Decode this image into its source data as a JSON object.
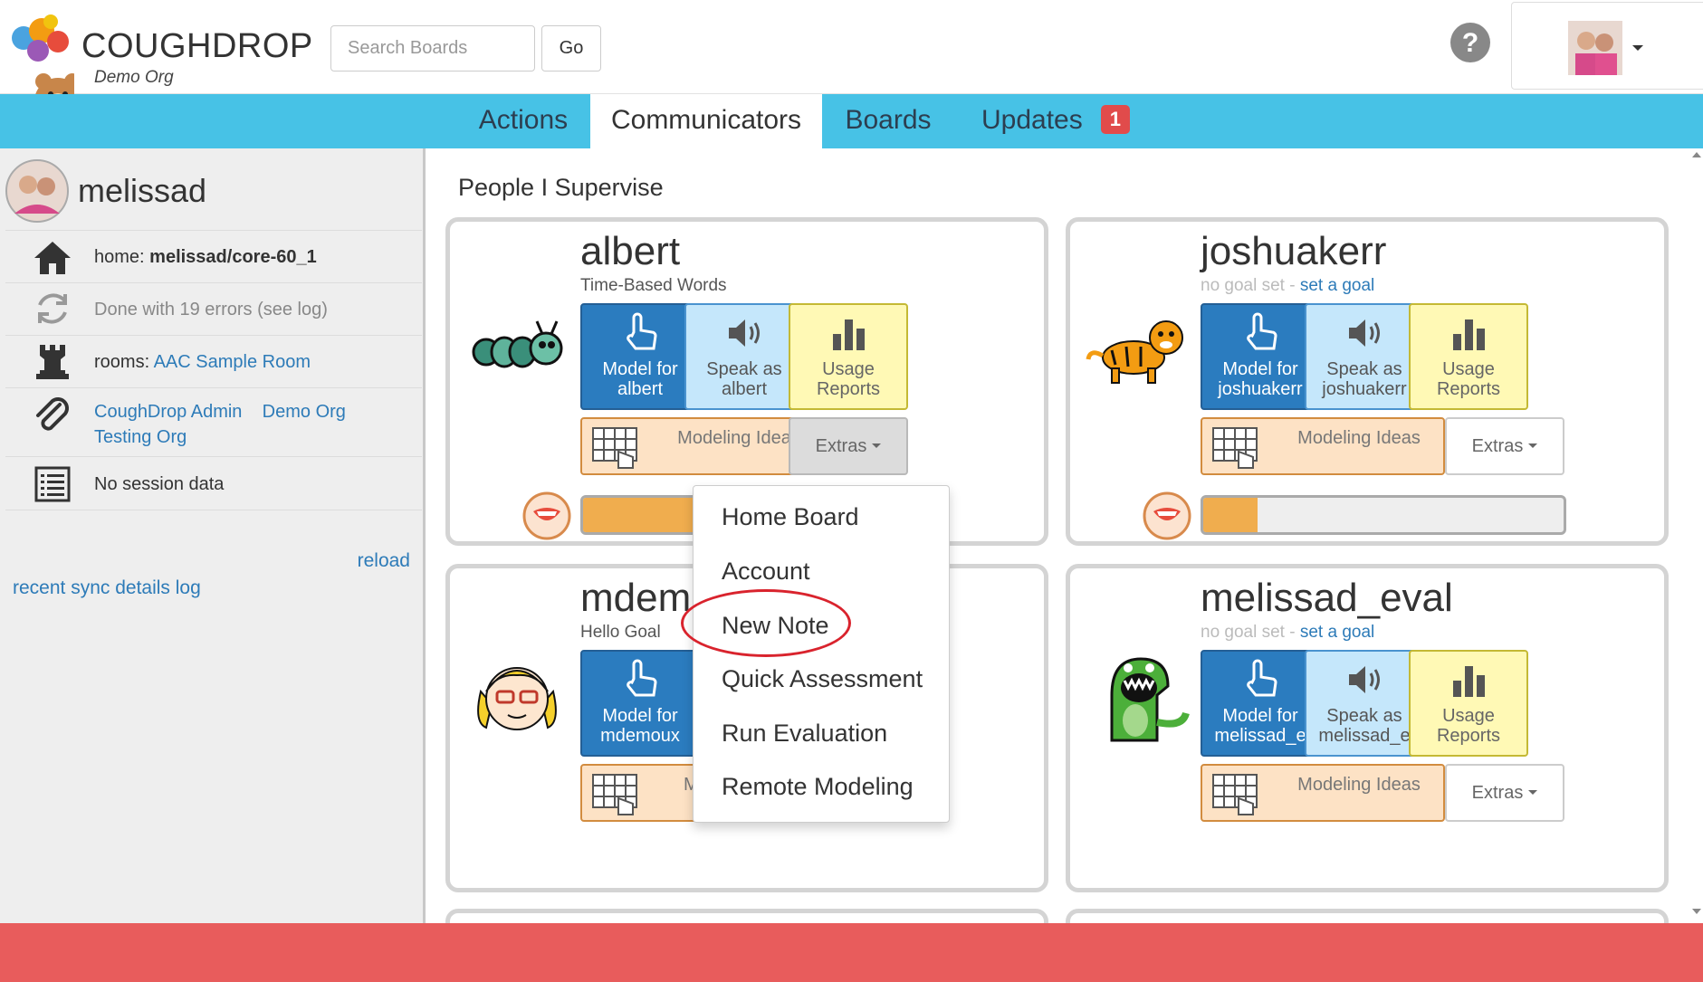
{
  "header": {
    "brand": "COUGHDROP",
    "org": "Demo Org",
    "search_placeholder": "Search Boards",
    "go_label": "Go"
  },
  "nav": {
    "tabs": [
      {
        "label": "Actions"
      },
      {
        "label": "Communicators",
        "active": true
      },
      {
        "label": "Boards"
      },
      {
        "label": "Updates",
        "badge": "1"
      }
    ]
  },
  "sidebar": {
    "username": "melissad",
    "home_prefix": "home: ",
    "home_board": "melissad/core-60_1",
    "sync_status": "Done with 19 errors (see log)",
    "rooms_prefix": "rooms: ",
    "rooms_link": "AAC Sample Room",
    "orgs": [
      "CoughDrop Admin",
      "Demo Org",
      "Testing Org"
    ],
    "session": "No session data",
    "reload": "reload",
    "sync_log": "recent sync details log"
  },
  "main": {
    "title": "People I Supervise",
    "cards": [
      {
        "name": "albert",
        "goal": "Time-Based Words",
        "model": "Model for albert",
        "speak": "Speak as albert",
        "usage": "Usage Reports",
        "modeling": "Modeling Ideas",
        "extras": "Extras",
        "progress": 0.45
      },
      {
        "name": "joshuakerr",
        "no_goal": "no goal set",
        "sep": " - ",
        "set_goal": "set a goal",
        "model": "Model for joshuakerr",
        "speak": "Speak as joshuakerr",
        "usage": "Usage Reports",
        "modeling": "Modeling Ideas",
        "extras": "Extras",
        "progress": 0.15
      },
      {
        "name": "mdem",
        "goal": "Hello Goal",
        "model": "Model for mdemoux",
        "modeling": "M"
      },
      {
        "name": "melissad_eval",
        "no_goal": "no goal set",
        "sep": " - ",
        "set_goal": "set a goal",
        "model": "Model for melissad_e",
        "speak": "Speak as melissad_e",
        "usage": "Usage Reports",
        "modeling": "Modeling Ideas",
        "extras": "Extras"
      }
    ]
  },
  "dropdown": {
    "items": [
      "Home Board",
      "Account",
      "New Note",
      "Quick Assessment",
      "Run Evaluation",
      "Remote Modeling"
    ]
  },
  "colors": {
    "nav": "#47c2e6",
    "footer": "#e85c5c",
    "model_tile": "#2b7cbf",
    "speak_tile": "#c5e7fb",
    "usage_tile": "#fff9b5",
    "modeling_tile": "#fde2c5",
    "highlight_circle": "#d9232d"
  }
}
